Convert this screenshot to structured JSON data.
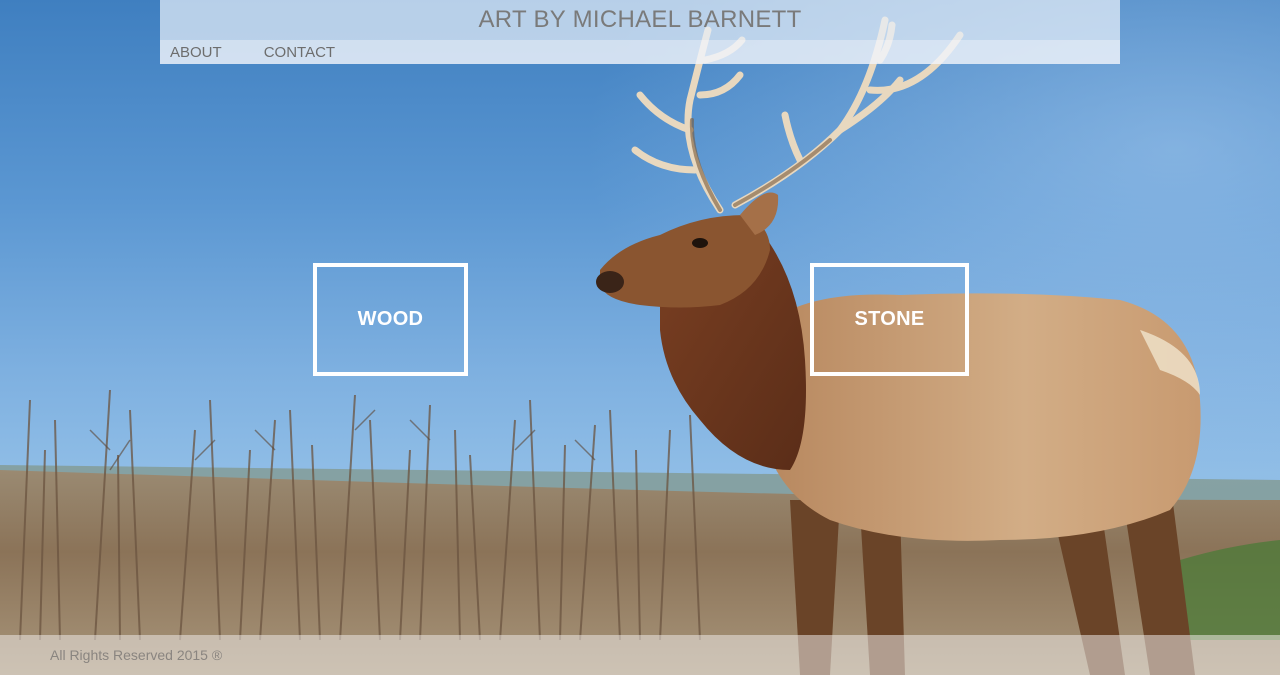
{
  "header": {
    "title": "ART BY MICHAEL BARNETT",
    "nav": [
      {
        "label": "ABOUT"
      },
      {
        "label": "CONTACT"
      }
    ]
  },
  "hero": {
    "image": "elk-icon",
    "categories": [
      {
        "label": "WOOD"
      },
      {
        "label": "STONE"
      }
    ]
  },
  "footer": {
    "text": "All Rights Reserved 2015 ®"
  },
  "colors": {
    "sky": "#5b97d2",
    "box_border": "#ffffff",
    "title_text": "#7a7a7a"
  }
}
